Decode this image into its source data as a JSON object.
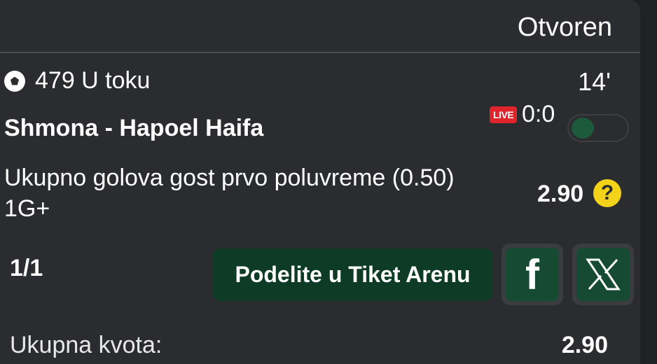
{
  "ticket": {
    "status": "Otvoren",
    "match_line": "479 U toku",
    "minute": "14'",
    "teams": "Shmona - Hapoel Haifa",
    "live_badge": "LIVE",
    "score": "0:0",
    "market": "Ukupno golova gost prvo poluvreme (0.50)",
    "selection": "1G+",
    "odd": "2.90",
    "help_symbol": "?"
  },
  "footer": {
    "count": "1/1",
    "share_label": "Podelite u Tiket Arenu",
    "facebook_glyph": "f",
    "total_label": "Ukupna kvota:",
    "total_value": "2.90"
  },
  "icons": {
    "ball": "soccer-ball-icon",
    "help": "question-icon",
    "facebook": "facebook-icon",
    "x": "x-icon"
  },
  "colors": {
    "accent_green": "#0d3b26",
    "live_red": "#e0242b",
    "help_yellow": "#f3d21a"
  }
}
